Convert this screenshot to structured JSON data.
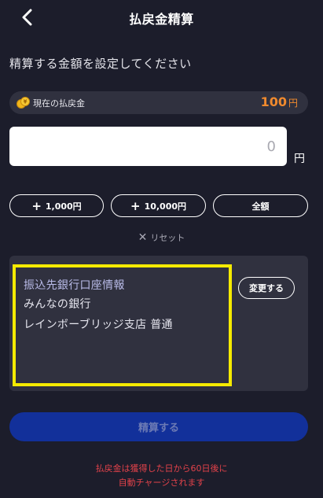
{
  "header": {
    "title": "払戻金精算",
    "back_icon": "chevron-left-icon"
  },
  "instruction": "精算する金額を設定してください",
  "balance": {
    "icon": "coin-bag-icon",
    "label": "現在の払戻金",
    "value": "100",
    "unit": "円",
    "value_color": "#f08a2e"
  },
  "amount": {
    "placeholder": "0",
    "unit": "円"
  },
  "quick_buttons": {
    "plus_1000": {
      "sign": "+",
      "label": "1,000円"
    },
    "plus_10000": {
      "sign": "+",
      "label": "10,000円"
    },
    "all": {
      "label": "全額"
    }
  },
  "reset": {
    "icon": "close-icon",
    "glyph": "✕",
    "label": "リセット"
  },
  "bank_info": {
    "heading": "振込先銀行口座情報",
    "bank_name": "みんなの銀行",
    "branch": "レインボーブリッジ支店 普通",
    "change_label": "変更する",
    "highlight_color": "#f5ea00"
  },
  "settle_button": {
    "label": "精算する",
    "color": "#12309a"
  },
  "notice": {
    "line1": "払戻金は獲得した日から60日後に",
    "line2": "自動チャージされます",
    "color": "#e2424a"
  }
}
